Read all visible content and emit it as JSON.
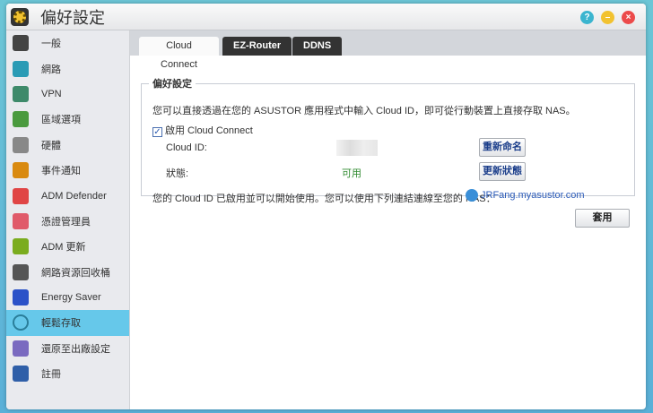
{
  "window": {
    "title": "偏好設定"
  },
  "sidebar": {
    "items": [
      {
        "label": "一般",
        "icon": "server-icon",
        "color": "#444"
      },
      {
        "label": "網路",
        "icon": "globe-icon",
        "color": "#2a9bb5"
      },
      {
        "label": "VPN",
        "icon": "house-icon",
        "color": "#3e8a6a"
      },
      {
        "label": "區域選項",
        "icon": "region-icon",
        "color": "#4a9a3e"
      },
      {
        "label": "硬體",
        "icon": "hardware-icon",
        "color": "#888"
      },
      {
        "label": "事件通知",
        "icon": "alert-icon",
        "color": "#d98a10"
      },
      {
        "label": "ADM Defender",
        "icon": "firewall-icon",
        "color": "#e04545"
      },
      {
        "label": "憑證管理員",
        "icon": "certificate-icon",
        "color": "#e05a6a"
      },
      {
        "label": "ADM 更新",
        "icon": "update-arrow-icon",
        "color": "#7aac1e"
      },
      {
        "label": "網路資源回收桶",
        "icon": "trash-icon",
        "color": "#555"
      },
      {
        "label": "Energy Saver",
        "icon": "lightning-icon",
        "color": "#2b52c8"
      },
      {
        "label": "輕鬆存取",
        "icon": "cloud-upload-icon",
        "color": "#2a7e9a"
      },
      {
        "label": "還原至出廠設定",
        "icon": "undo-icon",
        "color": "#7a6ac0"
      },
      {
        "label": "註冊",
        "icon": "register-icon",
        "color": "#2f5fa8"
      }
    ],
    "selected": 11
  },
  "tabs": [
    "Cloud Connect",
    "EZ-Router",
    "DDNS"
  ],
  "panel": {
    "legend": "偏好設定",
    "description": "您可以直接透過在您的 ASUSTOR 應用程式中輸入 Cloud ID，即可從行動裝置上直接存取 NAS。",
    "enable_label": "啟用 Cloud Connect",
    "cloud_id_label": "Cloud ID:",
    "status_label": "狀態:",
    "status_value": "可用",
    "rename_button": "重新命名",
    "refresh_button": "更新狀態",
    "ready_text": "您的 Cloud ID 已啟用並可以開始使用。您可以使用下列連結連線至您的 NAS：",
    "link": "JRFang.myasustor.com"
  },
  "apply_button": "套用"
}
